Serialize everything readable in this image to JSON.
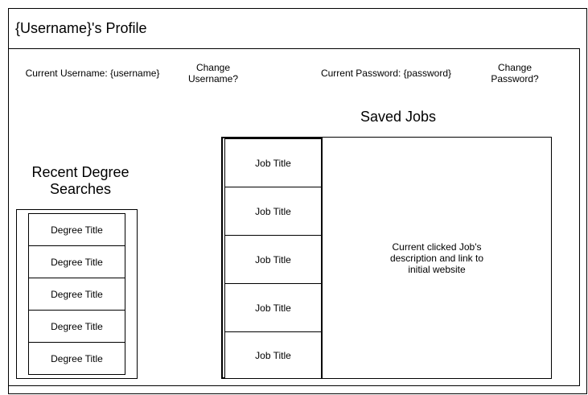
{
  "page": {
    "title": "{Username}'s Profile"
  },
  "account": {
    "current_username": "Current Username: {username}",
    "change_username": "Change Username?",
    "current_password": "Current Password: {password}",
    "change_password": "Change Password?"
  },
  "recent_degree_searches": {
    "heading": "Recent Degree Searches",
    "items": [
      "Degree Title",
      "Degree Title",
      "Degree Title",
      "Degree Title",
      "Degree Title"
    ]
  },
  "saved_jobs": {
    "heading": "Saved Jobs",
    "items": [
      "Job Title",
      "Job Title",
      "Job Title",
      "Job Title",
      "Job Title"
    ],
    "description": "Current clicked Job's description and link to initial website"
  }
}
